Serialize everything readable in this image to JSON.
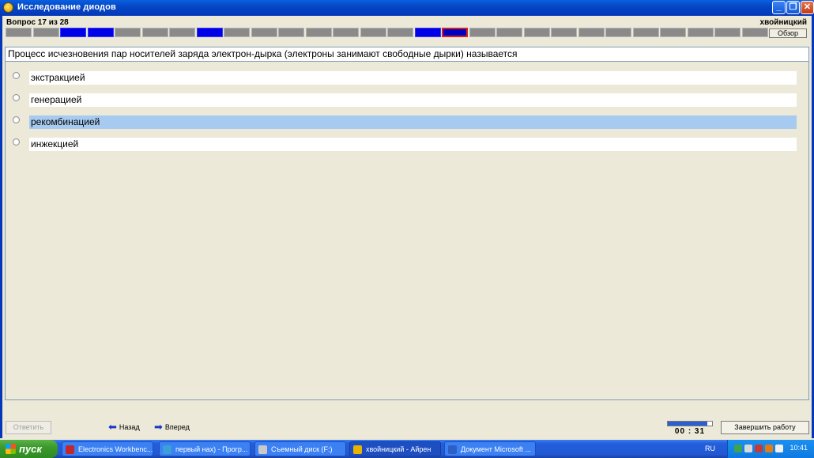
{
  "window": {
    "title": "Исследование диодов"
  },
  "header": {
    "question_counter": "Вопрос 17 из 28",
    "username": "хвойницкий",
    "overview_label": "Обзор"
  },
  "progress": {
    "total": 28,
    "current": 17,
    "answered": [
      3,
      4,
      8,
      16
    ]
  },
  "question": {
    "text": "Процесс исчезновения пар носителей заряда электрон-дырка (электроны занимают свободные дырки) называется",
    "options": [
      {
        "label": "экстракцией",
        "selected": false
      },
      {
        "label": "генерацией",
        "selected": false
      },
      {
        "label": "рекомбинацией",
        "selected": true
      },
      {
        "label": "инжекцией",
        "selected": false
      }
    ]
  },
  "footer": {
    "answer_label": "Ответить",
    "back_label": "Назад",
    "forward_label": "Вперед",
    "timer": "00 : 31",
    "timer_progress": 0.9,
    "finish_label": "Завершить работу"
  },
  "taskbar": {
    "start_label": "пуск",
    "tasks": [
      {
        "label": "Electronics Workbenc...",
        "icon_color": "#c0282e"
      },
      {
        "label": "первый нах) - Прогр...",
        "icon_color": "#3aa0d8"
      },
      {
        "label": "Съемный диск (F:)",
        "icon_color": "#c9c9c9"
      },
      {
        "label": "хвойницкий - Айрен",
        "icon_color": "#e8b400",
        "active": true
      },
      {
        "label": "Документ Microsoft ...",
        "icon_color": "#2d5fc4"
      }
    ],
    "language": "RU",
    "clock": "10:41"
  },
  "colors": {
    "answered_segment": "#0000e6",
    "pending_segment": "#8a8a8a",
    "current_outline": "#d22020",
    "selected_option": "#a6caf0"
  }
}
